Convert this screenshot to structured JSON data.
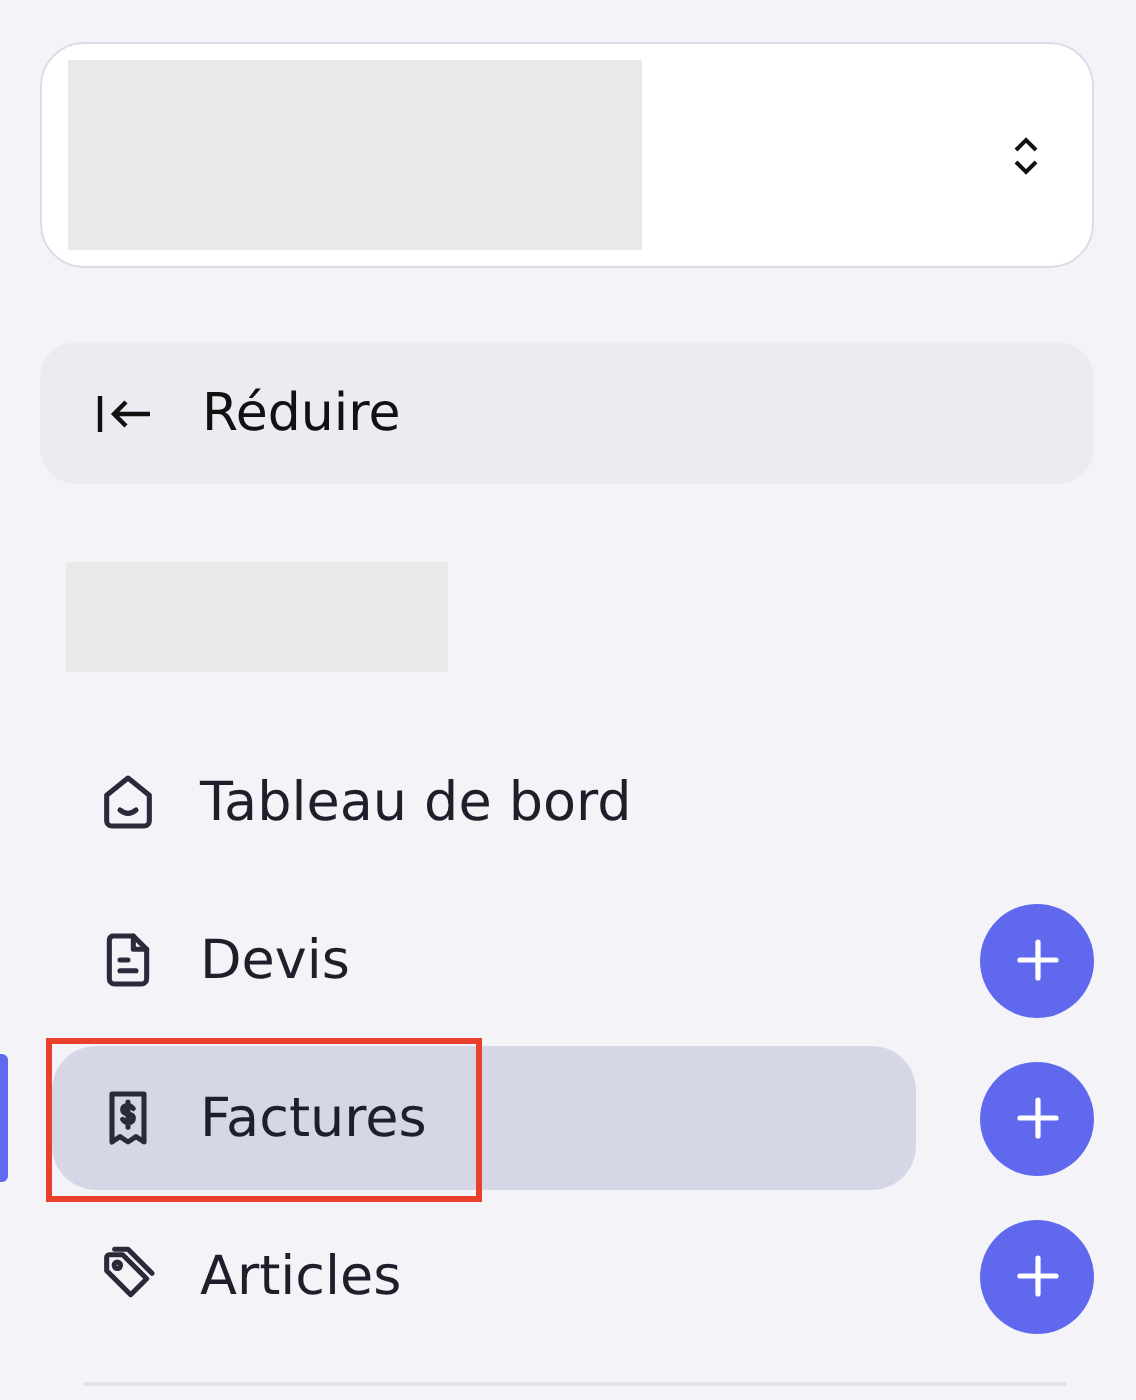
{
  "workspace_selector": {
    "redacted": true
  },
  "collapse_button": {
    "label": "Réduire"
  },
  "section_heading": {
    "redacted": true
  },
  "nav_items": [
    {
      "kind": "dashboard",
      "label": "Tableau de bord",
      "selected": false,
      "highlighted": false,
      "has_add": false
    },
    {
      "kind": "quote",
      "label": "Devis",
      "selected": false,
      "highlighted": false,
      "has_add": true
    },
    {
      "kind": "invoice",
      "label": "Factures",
      "selected": true,
      "highlighted": true,
      "has_add": true
    },
    {
      "kind": "article",
      "label": "Articles",
      "selected": false,
      "highlighted": false,
      "has_add": true
    }
  ]
}
